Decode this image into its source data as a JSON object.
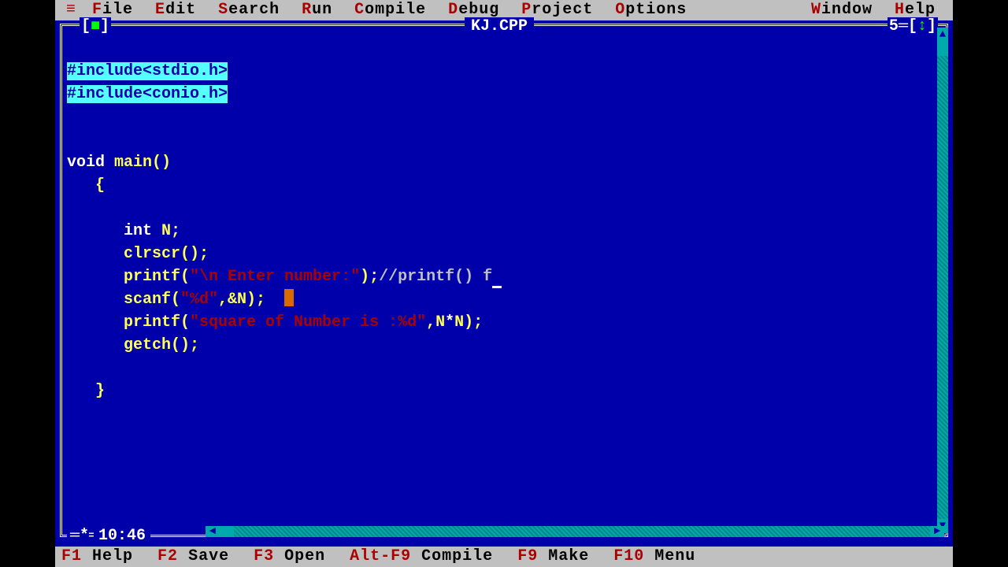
{
  "menu": {
    "sys": "≡",
    "items": [
      {
        "hot": "F",
        "rest": "ile"
      },
      {
        "hot": "E",
        "rest": "dit"
      },
      {
        "hot": "S",
        "rest": "earch"
      },
      {
        "hot": "R",
        "rest": "un"
      },
      {
        "hot": "C",
        "rest": "ompile"
      },
      {
        "hot": "D",
        "rest": "ebug"
      },
      {
        "hot": "P",
        "rest": "roject"
      },
      {
        "hot": "O",
        "rest": "ptions"
      }
    ],
    "right": [
      {
        "hot": "W",
        "rest": "indow"
      },
      {
        "hot": "H",
        "rest": "elp"
      }
    ]
  },
  "window": {
    "filename": "KJ.CPP",
    "winnum": "5",
    "closebox_l": "[",
    "closebox_sq": "■",
    "closebox_r": "]",
    "zoom_l": "[",
    "zoom_up": "↕",
    "zoom_r": "]",
    "mark": "═*═",
    "cursor_pos": "10:46"
  },
  "code": {
    "l1": "#include<stdio.h>",
    "l2": "#include<conio.h>",
    "l5_void": "void",
    "l5_main": " main",
    "l5_paren": "()",
    "l6": "   {",
    "l8_int": "      int",
    "l8_rest": " N;",
    "l9": "      clrscr();",
    "l10_a": "      printf(",
    "l10_str": "\"\\n Enter number:\"",
    "l10_b": ");",
    "l10_cmt": "//printf() f",
    "l11_a": "      scanf(",
    "l11_str": "\"%d\"",
    "l11_b": ",&N);",
    "l12_a": "      printf(",
    "l12_str": "\"square of Number is :%d\"",
    "l12_b": ",N",
    "l12_c": "*",
    "l12_d": "N);",
    "l13": "      getch();",
    "l15": "   }"
  },
  "status": {
    "items": [
      {
        "key": "F1",
        "label": " Help"
      },
      {
        "key": "F2",
        "label": " Save"
      },
      {
        "key": "F3",
        "label": " Open"
      },
      {
        "key": "Alt-F9",
        "label": " Compile"
      },
      {
        "key": "F9",
        "label": " Make"
      },
      {
        "key": "F10",
        "label": " Menu"
      }
    ]
  }
}
